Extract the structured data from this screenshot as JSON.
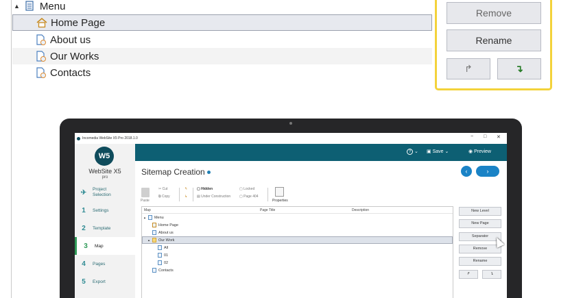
{
  "zoom_tree": {
    "menu_label": "Menu",
    "items": [
      "Home Page",
      "About us",
      "Our Works",
      "Contacts"
    ]
  },
  "zoom_buttons": {
    "remove": "Remove",
    "rename": "Rename",
    "up": "↱",
    "down": "↴"
  },
  "app": {
    "window_title": "Incomedia WebSite X5 Pro 2018.1.0",
    "window_controls": [
      "−",
      "□",
      "✕"
    ],
    "logo": "W5",
    "brand": "WebSite X5",
    "brand_sub": "pro",
    "topbar": {
      "help": "?",
      "save": "Save",
      "preview": "Preview"
    },
    "nav": [
      {
        "num": "",
        "label": "Project Selection"
      },
      {
        "num": "1",
        "label": "Settings"
      },
      {
        "num": "2",
        "label": "Template"
      },
      {
        "num": "3",
        "label": "Map"
      },
      {
        "num": "4",
        "label": "Pages"
      },
      {
        "num": "5",
        "label": "Export"
      }
    ],
    "page_title": "Sitemap Creation",
    "back": "‹",
    "forward": "›",
    "toolbar": {
      "paste": "Paste",
      "cut": "Cut",
      "copy": "Copy",
      "hidden": "Hidden",
      "under_construction": "Under Construction",
      "locked": "Locked",
      "page404": "Page 404",
      "properties": "Properties"
    },
    "table_headers": [
      "Map",
      "Page Title",
      "Description"
    ],
    "tree": [
      "Menu",
      "Home Page",
      "About us",
      "Our Work",
      "All",
      "01",
      "02",
      "Contacts"
    ],
    "buttons": [
      "New Level",
      "New Page",
      "Separator",
      "Remove",
      "Rename"
    ],
    "arrows": [
      "↱",
      "↴"
    ]
  }
}
